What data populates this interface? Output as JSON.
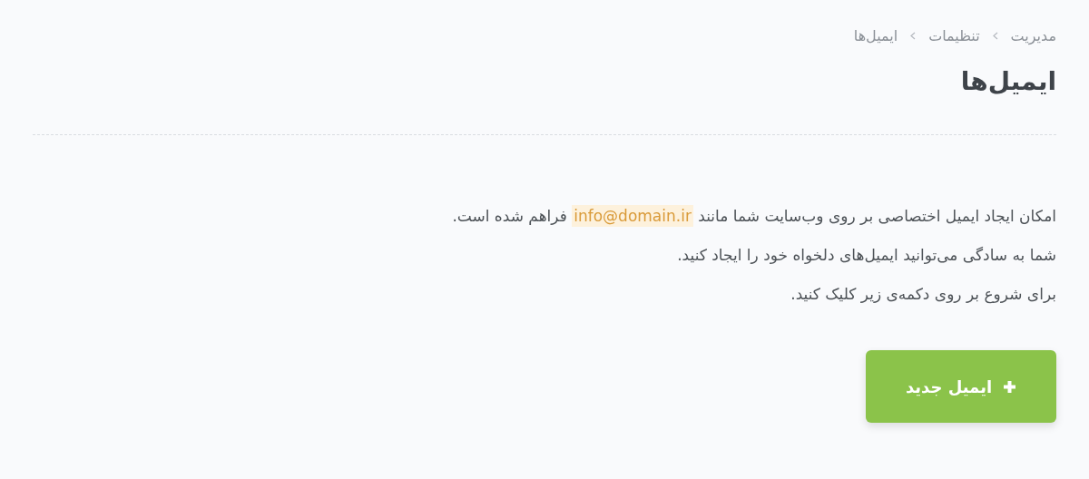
{
  "breadcrumb": [
    {
      "label": "مدیریت"
    },
    {
      "label": "تنظیمات"
    },
    {
      "label": "ایمیل‌ها"
    }
  ],
  "page_title": "ایمیل‌ها",
  "intro_lines": [
    [
      {
        "kind": "plain",
        "text": "امکان ایجاد ایمیل اختصاصی بر روی وب‌سایت شما مانند "
      },
      {
        "kind": "highlight",
        "text": "info@domain.ir"
      },
      {
        "kind": "plain",
        "text": " فراهم شده است."
      }
    ],
    [
      {
        "kind": "plain",
        "text": "شما به سادگی می‌توانید ایمیل‌های دلخواه خود را ایجاد کنید."
      }
    ],
    [
      {
        "kind": "plain",
        "text": "برای شروع بر روی دکمه‌ی زیر کلیک کنید."
      }
    ]
  ],
  "new_button": {
    "label": "ایمیل جدید"
  }
}
